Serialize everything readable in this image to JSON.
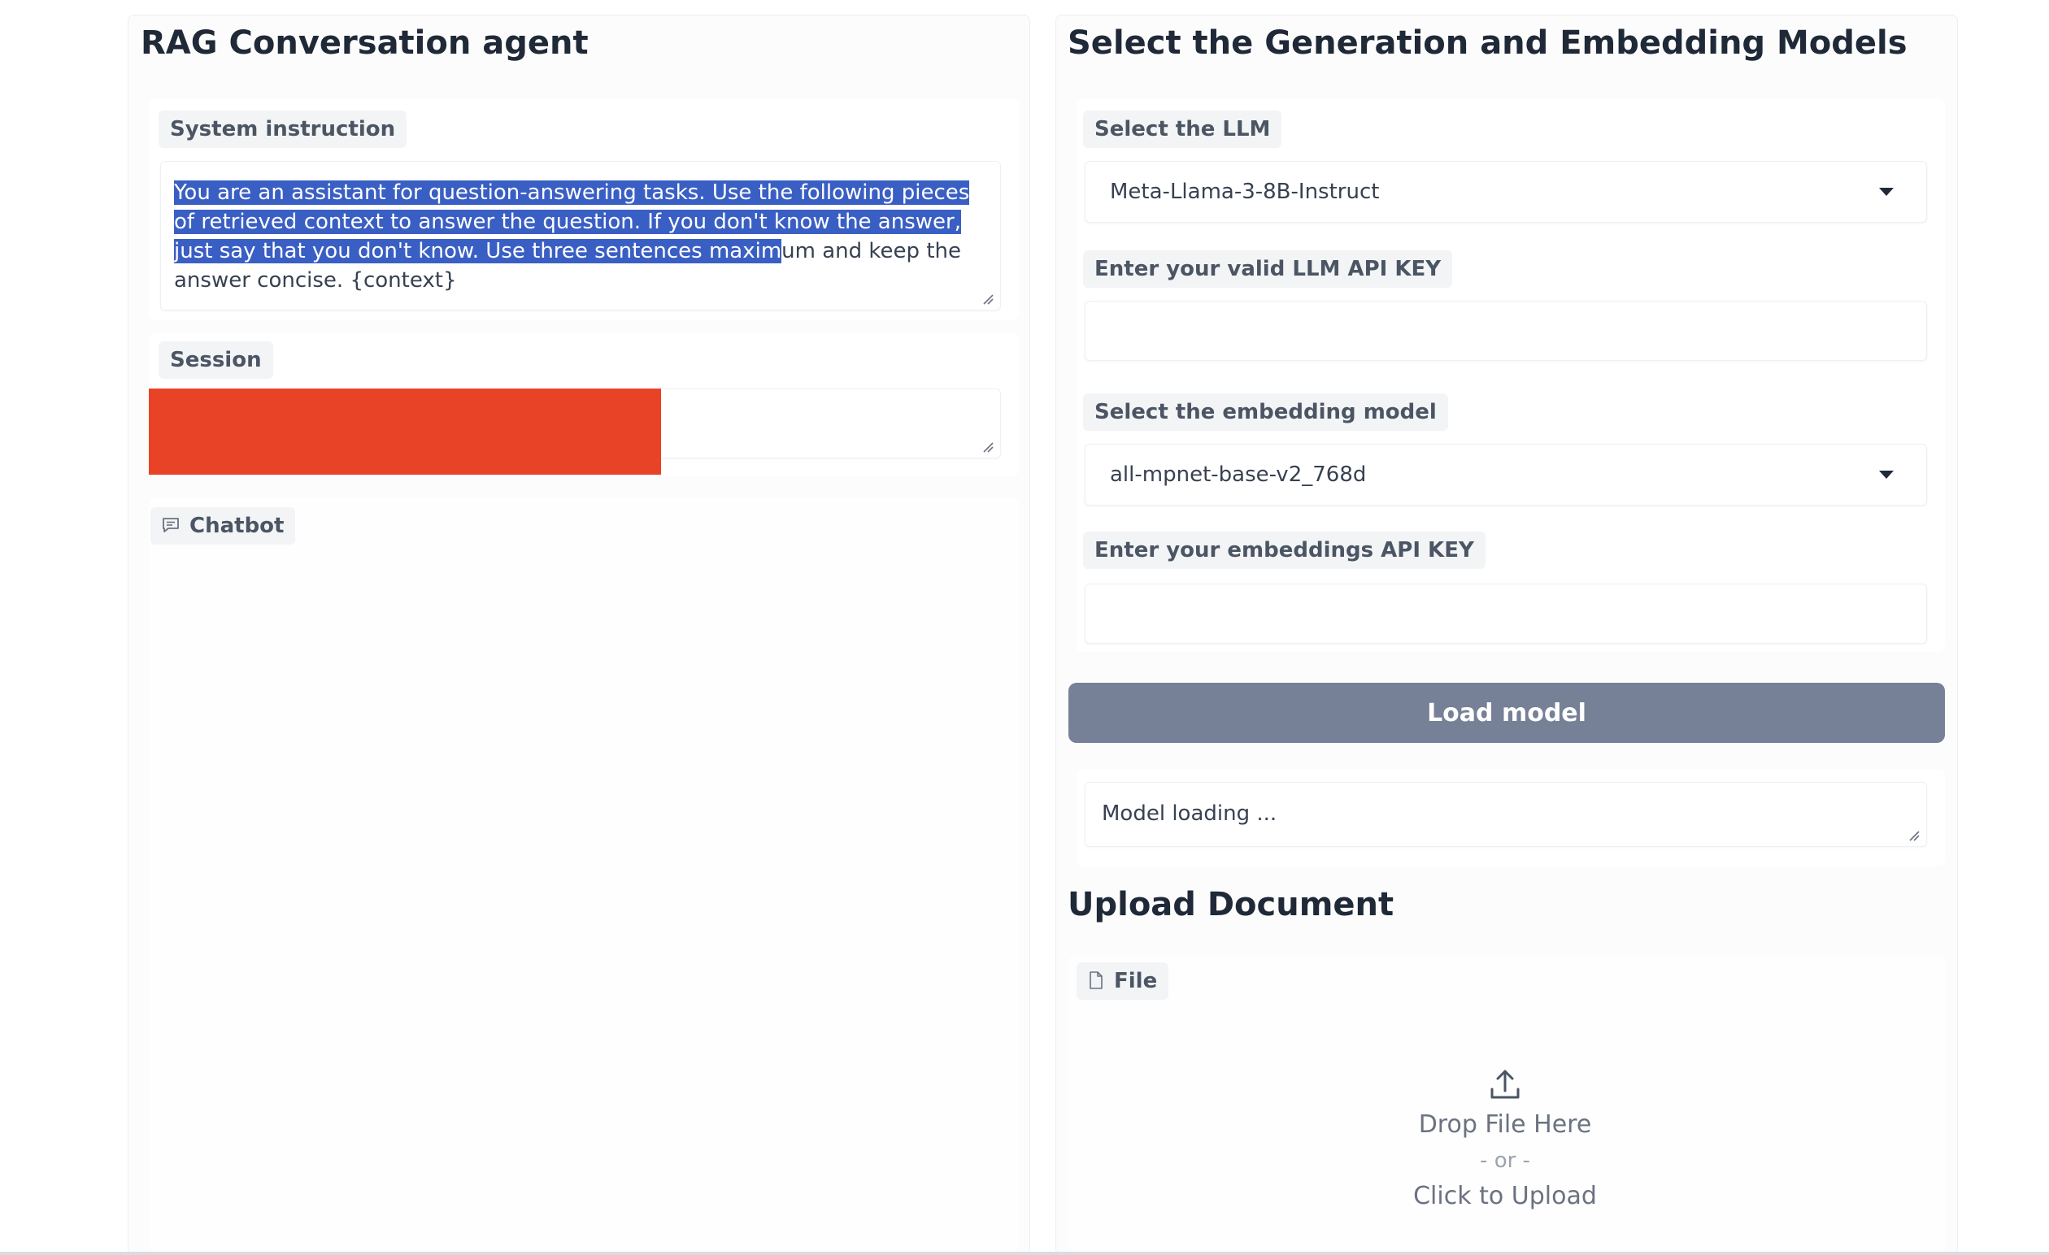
{
  "left_panel": {
    "title": "RAG Conversation agent",
    "system_instruction": {
      "label": "System instruction",
      "text_selected": "You are an assistant for question-answering tasks. Use the following pieces of retrieved context to answer the question. If you don't know the answer, just say that you don't know. Use three sentences maxim",
      "text_rest": "um and keep the answer concise. {context}"
    },
    "session": {
      "label": "Session",
      "value": ""
    },
    "chatbot": {
      "label": "Chatbot"
    }
  },
  "right_panel": {
    "title": "Select the Generation and Embedding Models",
    "llm": {
      "label": "Select the LLM",
      "selected": "Meta-Llama-3-8B-Instruct"
    },
    "llm_api_key": {
      "label": "Enter your valid LLM API KEY",
      "value": ""
    },
    "embedding": {
      "label": "Select the embedding model",
      "selected": "all-mpnet-base-v2_768d"
    },
    "embedding_api_key": {
      "label": "Enter your embeddings API KEY",
      "value": ""
    },
    "load_button": "Load model",
    "status_text": "Model loading ...",
    "upload": {
      "title": "Upload Document",
      "file_label": "File",
      "drop_text": "Drop File Here",
      "or_text": "- or -",
      "click_text": "Click to Upload"
    }
  },
  "colors": {
    "selection": "#3a5fc4",
    "button": "#768096",
    "redaction": "#e84227"
  }
}
